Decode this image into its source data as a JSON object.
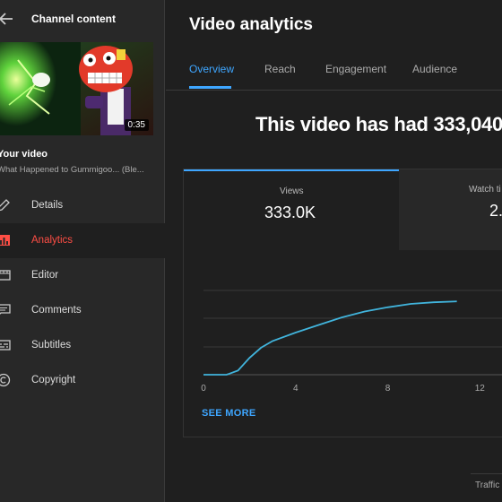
{
  "sidebar": {
    "title": "Channel content",
    "thumbnail": {
      "duration": "0:35"
    },
    "your_video_label": "Your video",
    "video_title": "What Happened to Gummigoo... (Ble...",
    "items": [
      {
        "label": "Details",
        "icon": "pencil-icon",
        "active": false
      },
      {
        "label": "Analytics",
        "icon": "analytics-icon",
        "active": true
      },
      {
        "label": "Editor",
        "icon": "film-icon",
        "active": false
      },
      {
        "label": "Comments",
        "icon": "comment-icon",
        "active": false
      },
      {
        "label": "Subtitles",
        "icon": "subtitles-icon",
        "active": false
      },
      {
        "label": "Copyright",
        "icon": "copyright-icon",
        "active": false
      }
    ]
  },
  "main": {
    "title": "Video analytics",
    "tabs": [
      {
        "label": "Overview",
        "active": true
      },
      {
        "label": "Reach",
        "active": false
      },
      {
        "label": "Engagement",
        "active": false
      },
      {
        "label": "Audience",
        "active": false
      }
    ],
    "headline": "This video has had 333,040",
    "metrics": [
      {
        "label": "Views",
        "value": "333.0K"
      },
      {
        "label": "Watch ti",
        "value": "2."
      }
    ],
    "see_more": "SEE MORE",
    "traffic_label": "Traffic"
  },
  "colors": {
    "accent": "#3ea6ff",
    "active_nav": "#ff4e45",
    "line": "#41b4dc"
  },
  "chart_data": {
    "type": "line",
    "x_ticks": [
      "0",
      "4",
      "8",
      "12"
    ],
    "xlim": [
      0,
      13
    ],
    "grid": true,
    "series": [
      {
        "x": [
          0,
          1,
          1.5,
          2,
          2.5,
          3,
          4,
          5,
          6,
          7,
          8,
          9,
          10,
          11
        ],
        "values": [
          0,
          0,
          5,
          20,
          32,
          40,
          50,
          59,
          68,
          75,
          80,
          84,
          86,
          87
        ]
      }
    ]
  }
}
